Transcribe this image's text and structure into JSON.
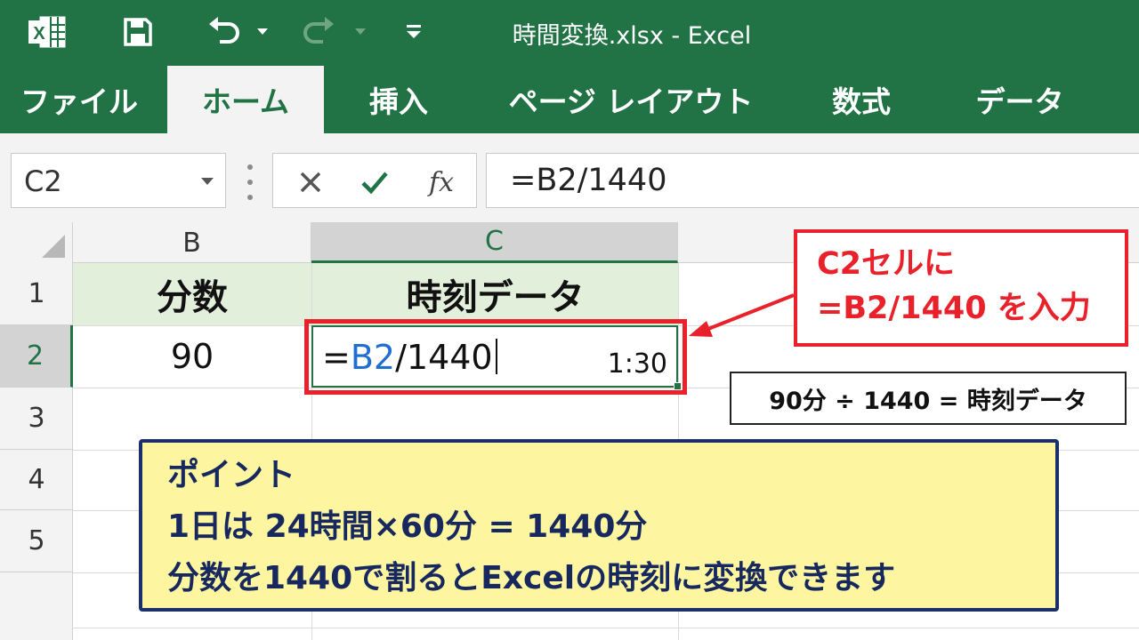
{
  "window": {
    "title": "時間変換.xlsx  -  Excel"
  },
  "icons": {
    "app": "excel-logo-icon",
    "save": "save-icon",
    "undo": "undo-icon",
    "redo": "redo-icon",
    "customize": "customize-toolbar-icon"
  },
  "ribbon": {
    "tabs": [
      {
        "label": "ファイル",
        "active": false
      },
      {
        "label": "ホーム",
        "active": true
      },
      {
        "label": "挿入",
        "active": false
      },
      {
        "label": "ページ レイアウト",
        "active": false
      },
      {
        "label": "数式",
        "active": false
      },
      {
        "label": "データ",
        "active": false
      }
    ]
  },
  "formula_bar": {
    "name_box": "C2",
    "cancel_icon": "×",
    "enter_icon": "✓",
    "fx_label": "fx",
    "formula": "=B2/1440"
  },
  "grid": {
    "column_headers": [
      "B",
      "C"
    ],
    "row_headers": [
      "1",
      "2",
      "3",
      "4",
      "5"
    ],
    "active_column": "C",
    "active_row": "2",
    "cells": {
      "B1": "分数",
      "C1": "時刻データ",
      "B2": "90",
      "C2_edit": {
        "prefix": "=",
        "ref": "B2",
        "suffix": "/1440",
        "result_tooltip": "1:30"
      }
    }
  },
  "callouts": {
    "instruction": {
      "line1": "C2セルに",
      "line2": "=B2/1440 を入力"
    },
    "equation": "90分 ÷ 1440 =  時刻データ",
    "point": {
      "title": "ポイント",
      "line1": "1日は 24時間×60分 = 1440分",
      "line2": "分数を1440で割るとExcelの時刻に変換できます"
    }
  },
  "colors": {
    "excel_green": "#217346",
    "highlight_red": "#e8212a",
    "header_cell_fill": "#e2efda",
    "point_fill": "#fdf5a0",
    "point_border": "#1b2f6b",
    "cell_ref_blue": "#1e6fd1"
  }
}
